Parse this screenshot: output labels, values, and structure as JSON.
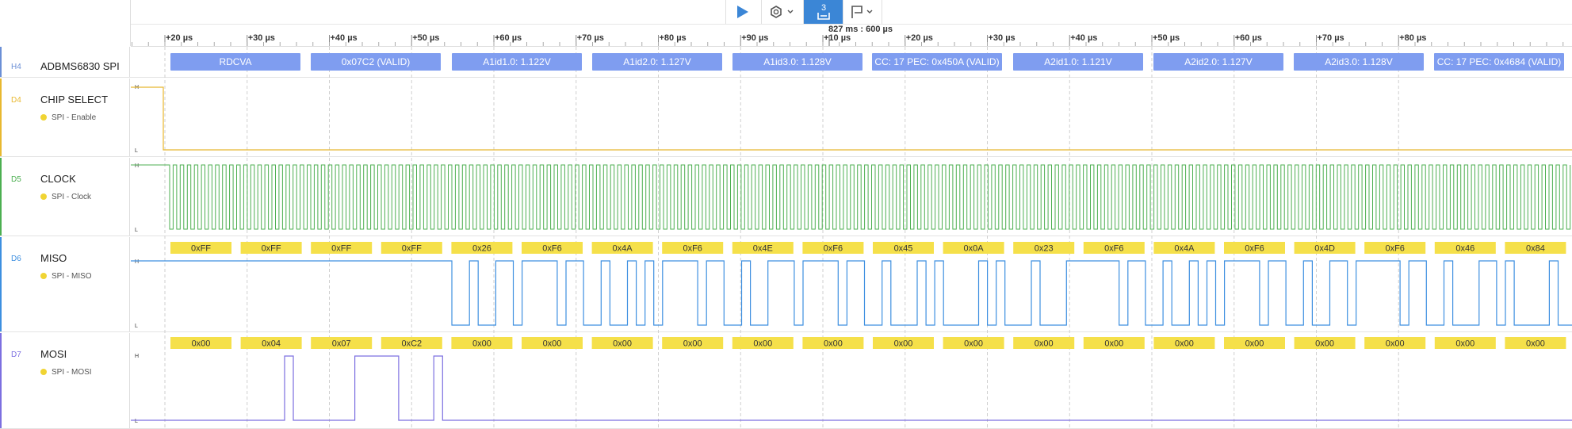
{
  "toolbar": {
    "play_icon": "play-icon",
    "settings_icon": "hexagon-settings-icon",
    "marker_count": "3",
    "marker_icon": "marker-pair-icon",
    "annotation_icon": "annotation-flag-icon",
    "accent": "#3b86d6"
  },
  "timeline": {
    "center_label": "827 ms : 600 µs",
    "ticks": [
      "+20 µs",
      "+30 µs",
      "+40 µs",
      "+50 µs",
      "+60 µs",
      "+70 µs",
      "+80 µs",
      "+90 µs",
      "+10 µs",
      "+20 µs",
      "+30 µs",
      "+40 µs",
      "+50 µs",
      "+60 µs",
      "+70 µs",
      "+80 µs"
    ]
  },
  "channels": {
    "spi": {
      "id": "H4",
      "name": "ADBMS6830 SPI",
      "color": "#6b8fd6",
      "frames": [
        "RDCVA",
        "0x07C2 (VALID)",
        "A1id1.0: 1.122V",
        "A1id2.0: 1.127V",
        "A1id3.0: 1.128V",
        "CC: 17 PEC: 0x450A (VALID)",
        "A2id1.0: 1.121V",
        "A2id2.0: 1.127V",
        "A2id3.0: 1.128V",
        "CC: 17 PEC: 0x4684 (VALID)"
      ]
    },
    "cs": {
      "id": "D4",
      "name": "CHIP SELECT",
      "sub": "SPI - Enable",
      "color": "#e8b830",
      "high": "H",
      "low": "L"
    },
    "clk": {
      "id": "D5",
      "name": "CLOCK",
      "sub": "SPI - Clock",
      "color": "#4caf50",
      "high": "H",
      "low": "L"
    },
    "miso": {
      "id": "D6",
      "name": "MISO",
      "sub": "SPI - MISO",
      "color": "#3d8fe0",
      "high": "H",
      "low": "L",
      "bytes": [
        "0xFF",
        "0xFF",
        "0xFF",
        "0xFF",
        "0x26",
        "0xF6",
        "0x4A",
        "0xF6",
        "0x4E",
        "0xF6",
        "0x45",
        "0x0A",
        "0x23",
        "0xF6",
        "0x4A",
        "0xF6",
        "0x4D",
        "0xF6",
        "0x46",
        "0x84"
      ]
    },
    "mosi": {
      "id": "D7",
      "name": "MOSI",
      "sub": "SPI - MOSI",
      "color": "#7c6fe0",
      "high": "H",
      "low": "L",
      "bytes": [
        "0x00",
        "0x04",
        "0x07",
        "0xC2",
        "0x00",
        "0x00",
        "0x00",
        "0x00",
        "0x00",
        "0x00",
        "0x00",
        "0x00",
        "0x00",
        "0x00",
        "0x00",
        "0x00",
        "0x00",
        "0x00",
        "0x00",
        "0x00"
      ]
    }
  },
  "colors": {
    "frame_fill": "#7f9df0",
    "byte_fill": "#f5e04a",
    "grid": "#cfcfcf"
  }
}
